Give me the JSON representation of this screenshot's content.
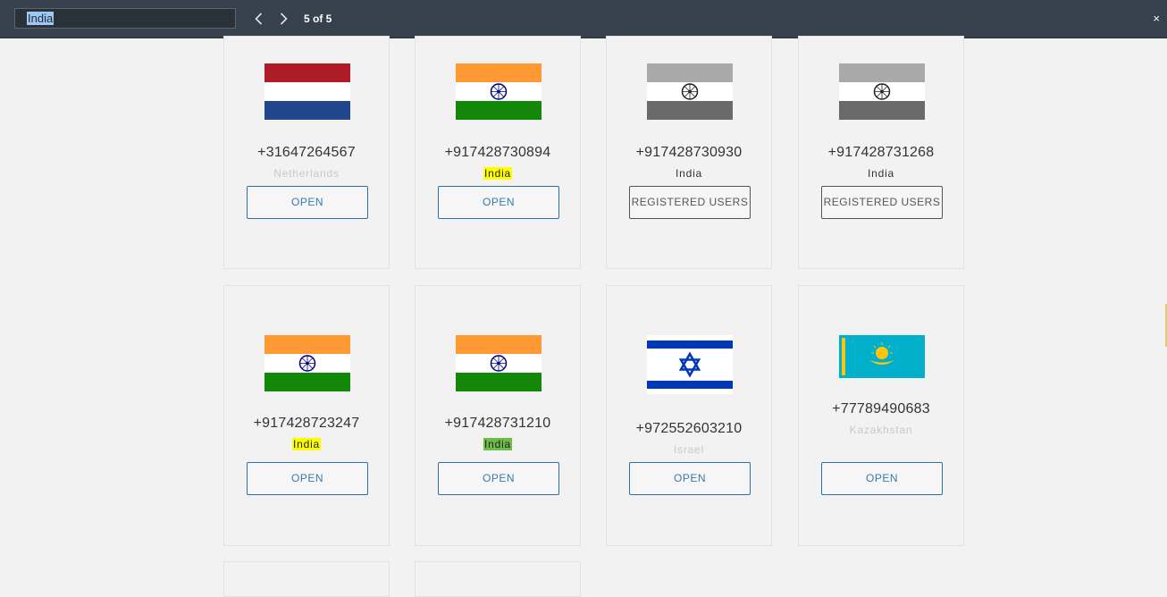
{
  "find_bar": {
    "query": "India",
    "count": "5 of 5",
    "prev_icon": "chevron-left-icon",
    "next_icon": "chevron-right-icon",
    "close_label": "×"
  },
  "colors": {
    "find_bar_bg": "#37414d",
    "button_blue": "#2f6fa8",
    "highlight_match": "#ffff00",
    "highlight_current": "#6dbd4a"
  },
  "cards": [
    {
      "phone": "+31647264567",
      "country": "Netherlands",
      "button": "OPEN",
      "flag": "netherlands-flag"
    },
    {
      "phone": "+917428730894",
      "country": "India",
      "button": "OPEN",
      "flag": "india-flag"
    },
    {
      "phone": "+917428730930",
      "country": "India",
      "button": "REGISTERED USERS",
      "flag": "india-flag-grayscale"
    },
    {
      "phone": "+917428731268",
      "country": "India",
      "button": "REGISTERED USERS",
      "flag": "india-flag-grayscale"
    },
    {
      "phone": "+917428723247",
      "country": "India",
      "button": "OPEN",
      "flag": "india-flag"
    },
    {
      "phone": "+917428731210",
      "country": "India",
      "button": "OPEN",
      "flag": "india-flag"
    },
    {
      "phone": "+972552603210",
      "country": "Israel",
      "button": "OPEN",
      "flag": "israel-flag"
    },
    {
      "phone": "+77789490683",
      "country": "Kazakhstan",
      "button": "OPEN",
      "flag": "kazakhstan-flag"
    }
  ]
}
